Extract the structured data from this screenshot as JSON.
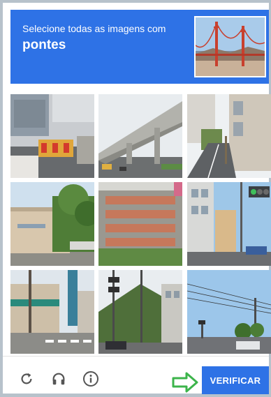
{
  "challenge": {
    "instruction": "Selecione todas as imagens com",
    "keyword": "pontes"
  },
  "sample_image": {
    "icon": "golden-gate-bridge-photo"
  },
  "tiles": [
    {
      "icon": "street-construction-photo"
    },
    {
      "icon": "elevated-highway-photo"
    },
    {
      "icon": "street-buildings-photo"
    },
    {
      "icon": "warehouse-photo"
    },
    {
      "icon": "crosswalk-stairs-photo"
    },
    {
      "icon": "street-traffic-light-photo"
    },
    {
      "icon": "shop-street-photo"
    },
    {
      "icon": "traffic-light-hill-photo"
    },
    {
      "icon": "sky-power-lines-photo"
    }
  ],
  "footer": {
    "reload_icon": "reload-icon",
    "audio_icon": "headphones-icon",
    "info_icon": "info-icon",
    "verify_label": "VERIFICAR"
  },
  "colors": {
    "accent": "#2e72e6",
    "arrow": "#3cb44b",
    "icon": "#555555"
  }
}
